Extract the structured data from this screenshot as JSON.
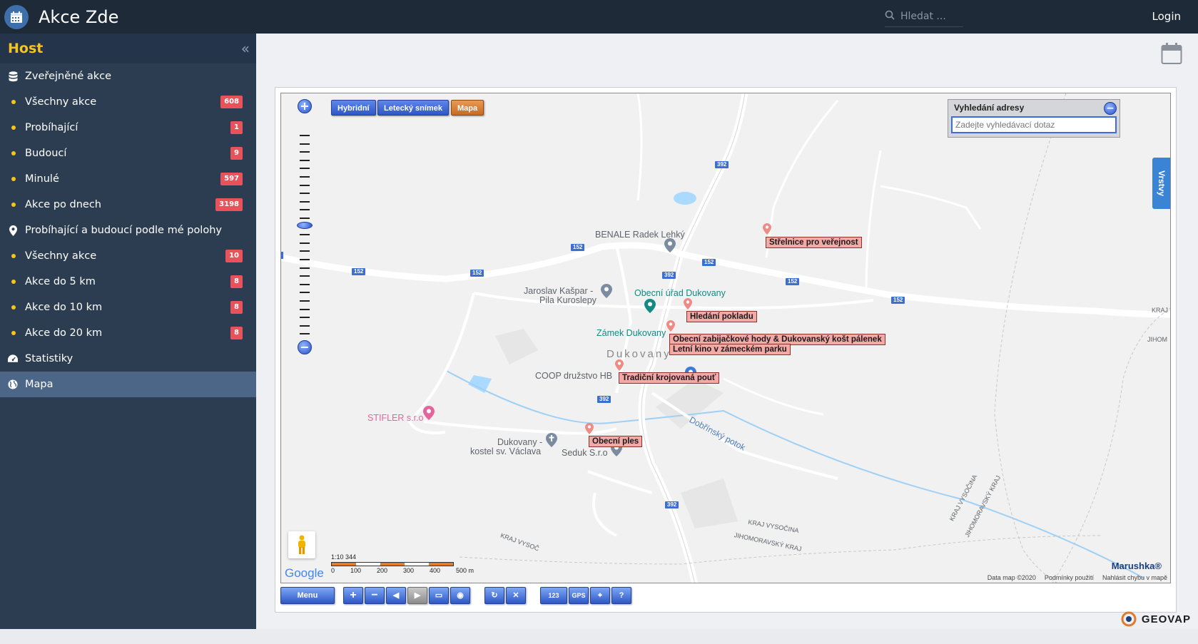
{
  "app": {
    "title": "Akce Zde"
  },
  "header": {
    "search_placeholder": "Hledat ...",
    "login_label": "Login"
  },
  "sidebar": {
    "role": "Host",
    "groups": [
      {
        "label": "Zveřejněné akce",
        "icon": "database-icon",
        "items": [
          {
            "label": "Všechny akce",
            "badge": "608"
          },
          {
            "label": "Probíhající",
            "badge": "1"
          },
          {
            "label": "Budoucí",
            "badge": "9"
          },
          {
            "label": "Minulé",
            "badge": "597"
          },
          {
            "label": "Akce po dnech",
            "badge": "3198"
          }
        ]
      },
      {
        "label": "Probíhající a budoucí podle mé polohy",
        "icon": "map-marker-icon",
        "items": [
          {
            "label": "Všechny akce",
            "badge": "10"
          },
          {
            "label": "Akce do 5 km",
            "badge": "8"
          },
          {
            "label": "Akce do 10 km",
            "badge": "8"
          },
          {
            "label": "Akce do 20 km",
            "badge": "8"
          }
        ]
      }
    ],
    "statistics_label": "Statistiky",
    "map_label": "Mapa"
  },
  "map": {
    "type_buttons": [
      "Hybridní",
      "Letecký snímek",
      "Mapa"
    ],
    "address_search": {
      "title": "Vyhledání adresy",
      "placeholder": "Zadejte vyhledávací dotaz"
    },
    "layers_tab": "Vrstvy",
    "events": [
      "Střelnice pro veřejnost",
      "Hledání pokladu",
      "Obecní zabijačkové hody & Dukovanský košt pálenek",
      "Letní kino v zámeckém parku",
      "Tradiční krojovaná pouť",
      "Obecní ples"
    ],
    "places": {
      "benale": "BENALE Radek Lehký",
      "kaspar_1": "Jaroslav Kašpar -",
      "kaspar_2": "Pila Kuroslepy",
      "obecni_urad": "Obecní úřad Dukovany",
      "zamek": "Zámek Dukovany",
      "village": "Dukovany",
      "coop": "COOP družstvo HB",
      "stifler": "STIFLER s.r.o",
      "kostel_1": "Dukovany -",
      "kostel_2": "kostel sv. Václava",
      "seduk": "Seduk S.r.o",
      "stream": "Dobřínský potok",
      "kraj_vys_1": "KRAJ VYSOČINA",
      "kraj_jm_1": "JIHOMORAVSKÝ KRAJ",
      "kraj_vys_2": "KRAJ VYSOČINA",
      "kraj_jm_2": "JIHOMORAVSKÝ KRAJ",
      "kraj_edge": "KRAJ",
      "jihom_edge": "JIHOM",
      "kraj_vys_bl": "KRAJ VYSOČ"
    },
    "roads": [
      "392",
      "392",
      "392",
      "392",
      "152",
      "152",
      "152",
      "152",
      "152",
      "152"
    ],
    "scale": {
      "ratio": "1:10 344",
      "ticks": [
        "0",
        "100",
        "200",
        "300",
        "400",
        "500 m"
      ]
    },
    "google_label": "Google",
    "brand": "Marushka®",
    "attribution": [
      "Data map ©2020",
      "Podmínky použití",
      "Nahlásit chybu v mapě"
    ],
    "toolbar": {
      "menu_label": "Menu",
      "gps_label": "GPS",
      "help_label": "?"
    }
  },
  "footer": {
    "brand": "GEOVAP"
  },
  "colors": {
    "header_bg": "#1f2a38",
    "sidebar_bg": "#2c3d52",
    "accent": "#f5c518",
    "badge": "#e8535b",
    "active": "#4b6686"
  }
}
